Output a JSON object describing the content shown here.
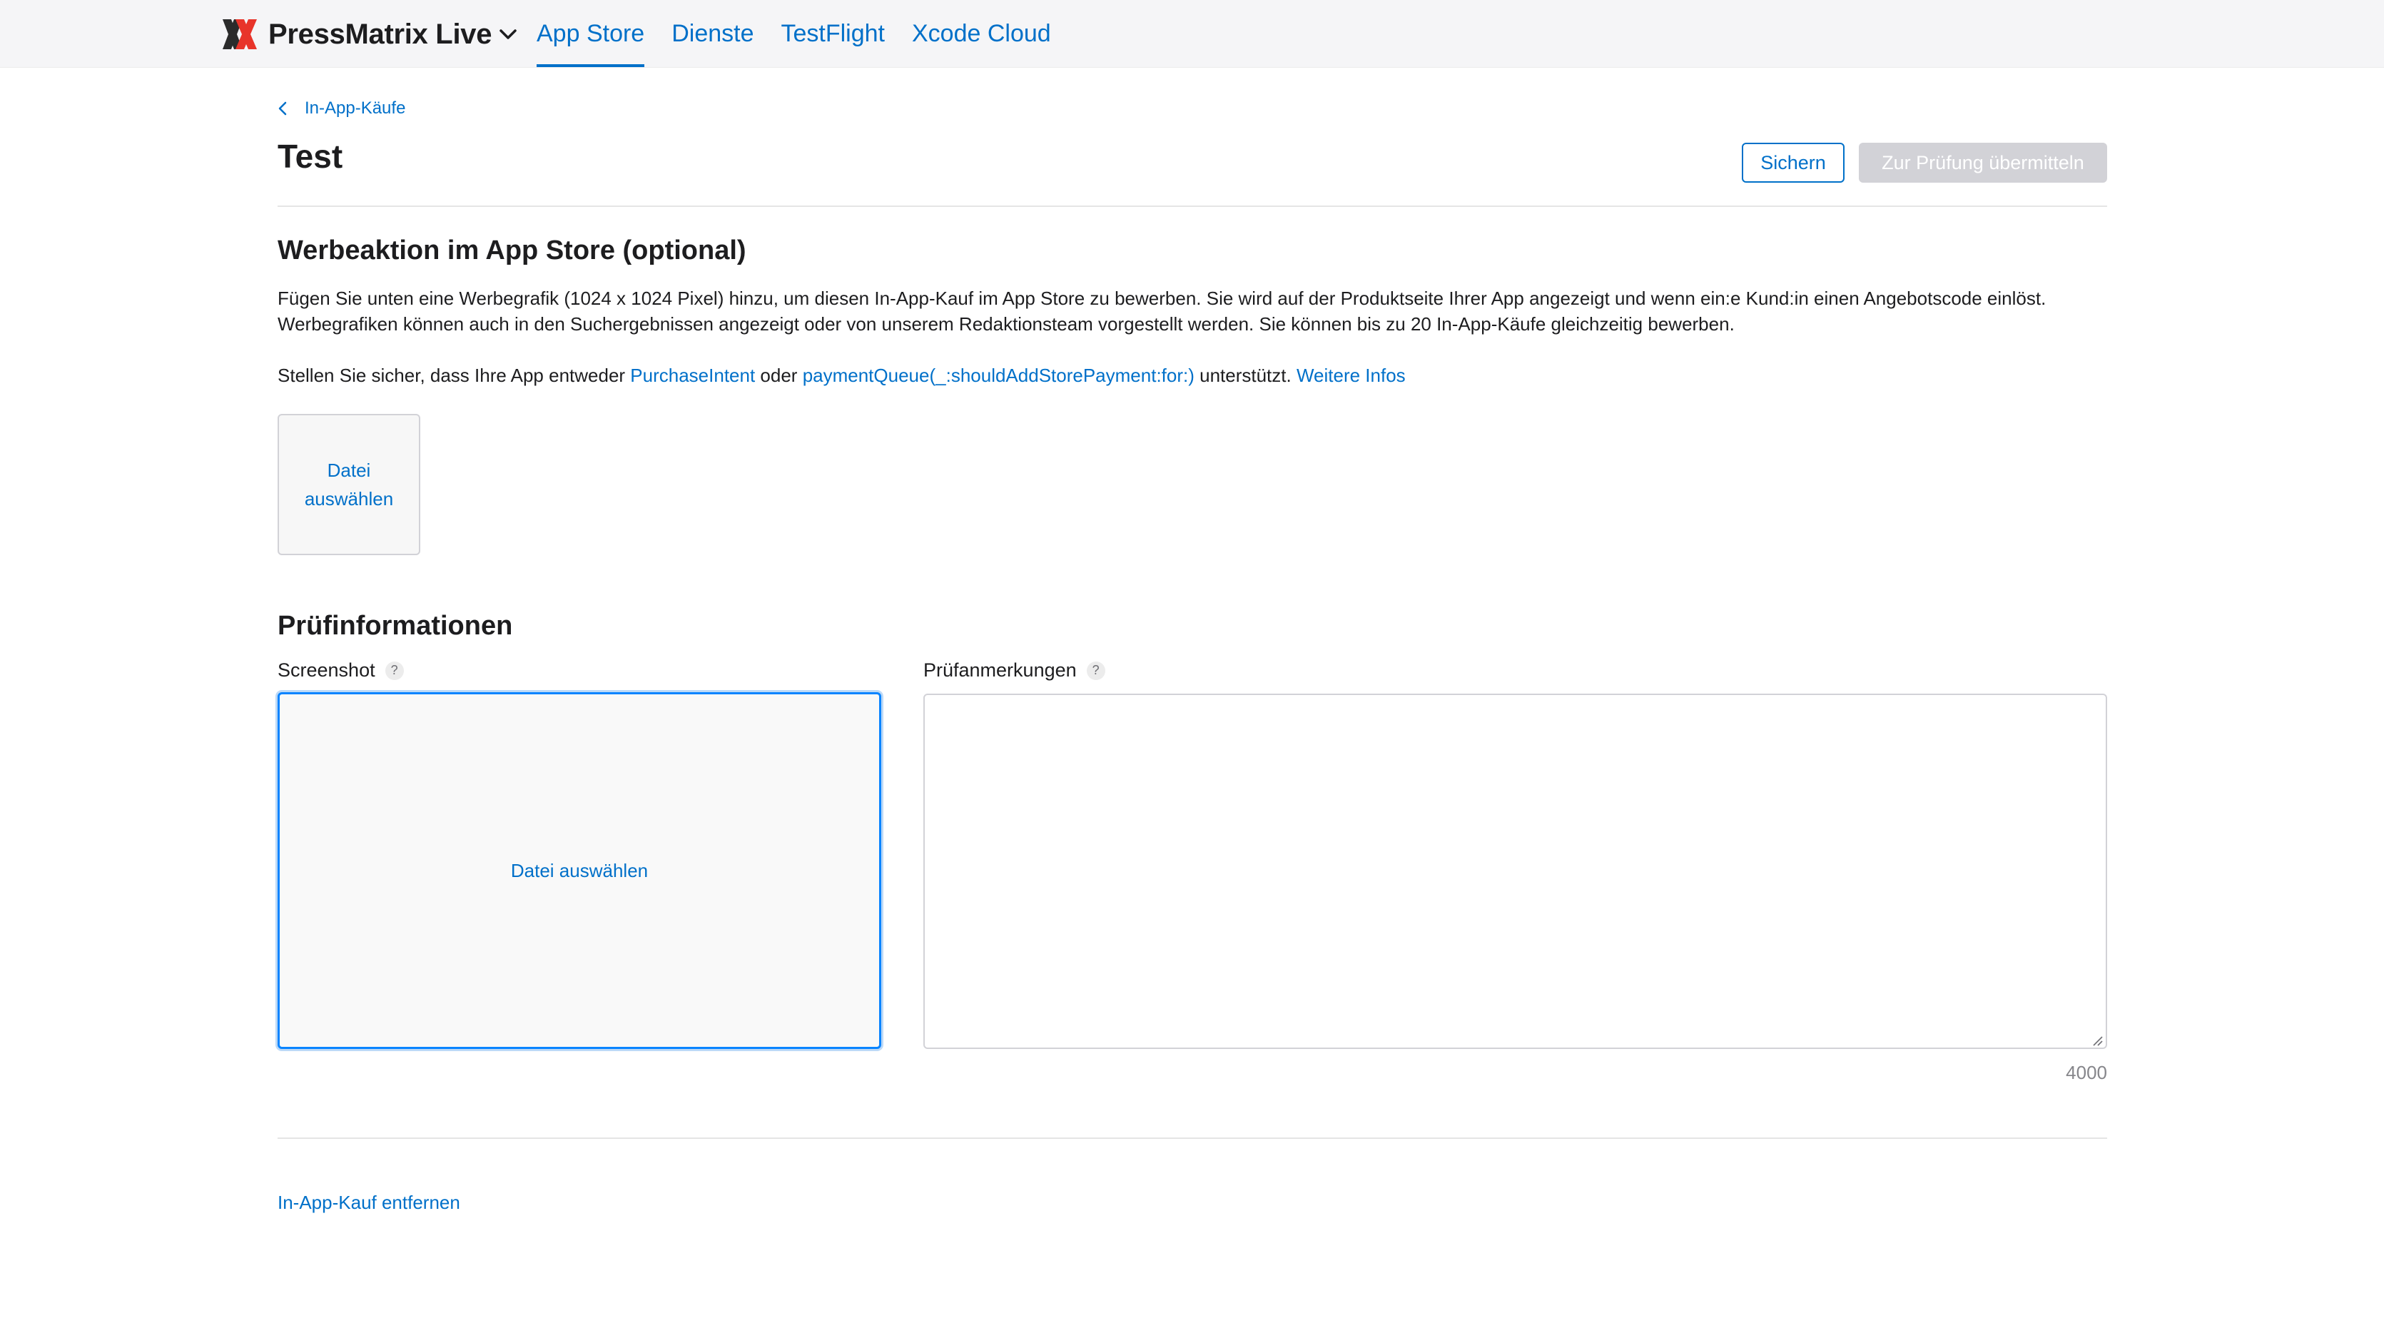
{
  "header": {
    "app_name": "PressMatrix Live",
    "tabs": [
      {
        "label": "App Store",
        "active": true
      },
      {
        "label": "Dienste",
        "active": false
      },
      {
        "label": "TestFlight",
        "active": false
      },
      {
        "label": "Xcode Cloud",
        "active": false
      }
    ]
  },
  "breadcrumb": {
    "label": "In-App-Käufe"
  },
  "page": {
    "title": "Test"
  },
  "actions": {
    "save_label": "Sichern",
    "submit_label": "Zur Prüfung übermitteln"
  },
  "promotion": {
    "title": "Werbeaktion im App Store (optional)",
    "description": "Fügen Sie unten eine Werbegrafik (1024 x 1024 Pixel) hinzu, um diesen In-App-Kauf im App Store zu bewerben. Sie wird auf der Produktseite Ihrer App angezeigt und wenn ein:e Kund:in einen Angebotscode einlöst. Werbegrafiken können auch in den Suchergebnissen angezeigt oder von unserem Redaktionsteam vorgestellt werden. Sie können bis zu 20 In-App-Käufe gleichzeitig bewerben.",
    "support_prefix": "Stellen Sie sicher, dass Ihre App entweder ",
    "link_purchase_intent": "PurchaseIntent",
    "support_or": " oder ",
    "link_payment_queue": "paymentQueue(_:shouldAddStorePayment:for:)",
    "support_suffix": " unterstützt. ",
    "link_more_info": "Weitere Infos",
    "file_button_line1": "Datei",
    "file_button_line2": "auswählen"
  },
  "review": {
    "title": "Prüfinformationen",
    "screenshot_label": "Screenshot",
    "screenshot_button": "Datei auswählen",
    "notes_label": "Prüfanmerkungen",
    "notes_value": "",
    "char_count": "4000",
    "help_symbol": "?"
  },
  "footer": {
    "remove_label": "In-App-Kauf entfernen"
  },
  "colors": {
    "accent": "#0070c9",
    "disabled_button": "#d2d2d7",
    "logo_red": "#e8342a",
    "logo_dark": "#2b2b2b"
  }
}
